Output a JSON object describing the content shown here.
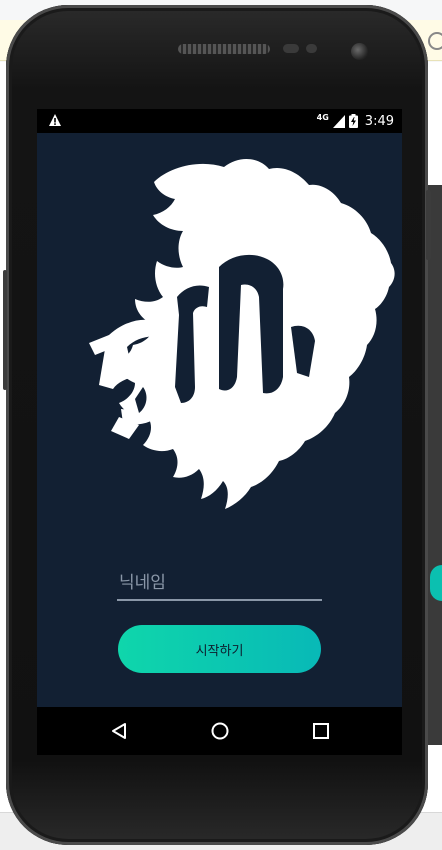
{
  "statusbar": {
    "warning_icon": "warning-icon",
    "network_type": "4G",
    "signal_icon": "signal-icon",
    "battery_icon": "battery-charging-icon",
    "time": "3:49"
  },
  "app": {
    "logo_icon": "lion-head-logo",
    "nickname_placeholder": "닉네임",
    "nickname_value": "",
    "start_button_label": "시작하기",
    "colors": {
      "background": "#122033",
      "button_gradient_start": "#0fd6ab",
      "button_gradient_end": "#08b9b7",
      "logo": "#ffffff"
    }
  },
  "navbar": {
    "back_icon": "back-triangle-icon",
    "home_icon": "home-circle-icon",
    "recents_icon": "recents-square-icon"
  }
}
